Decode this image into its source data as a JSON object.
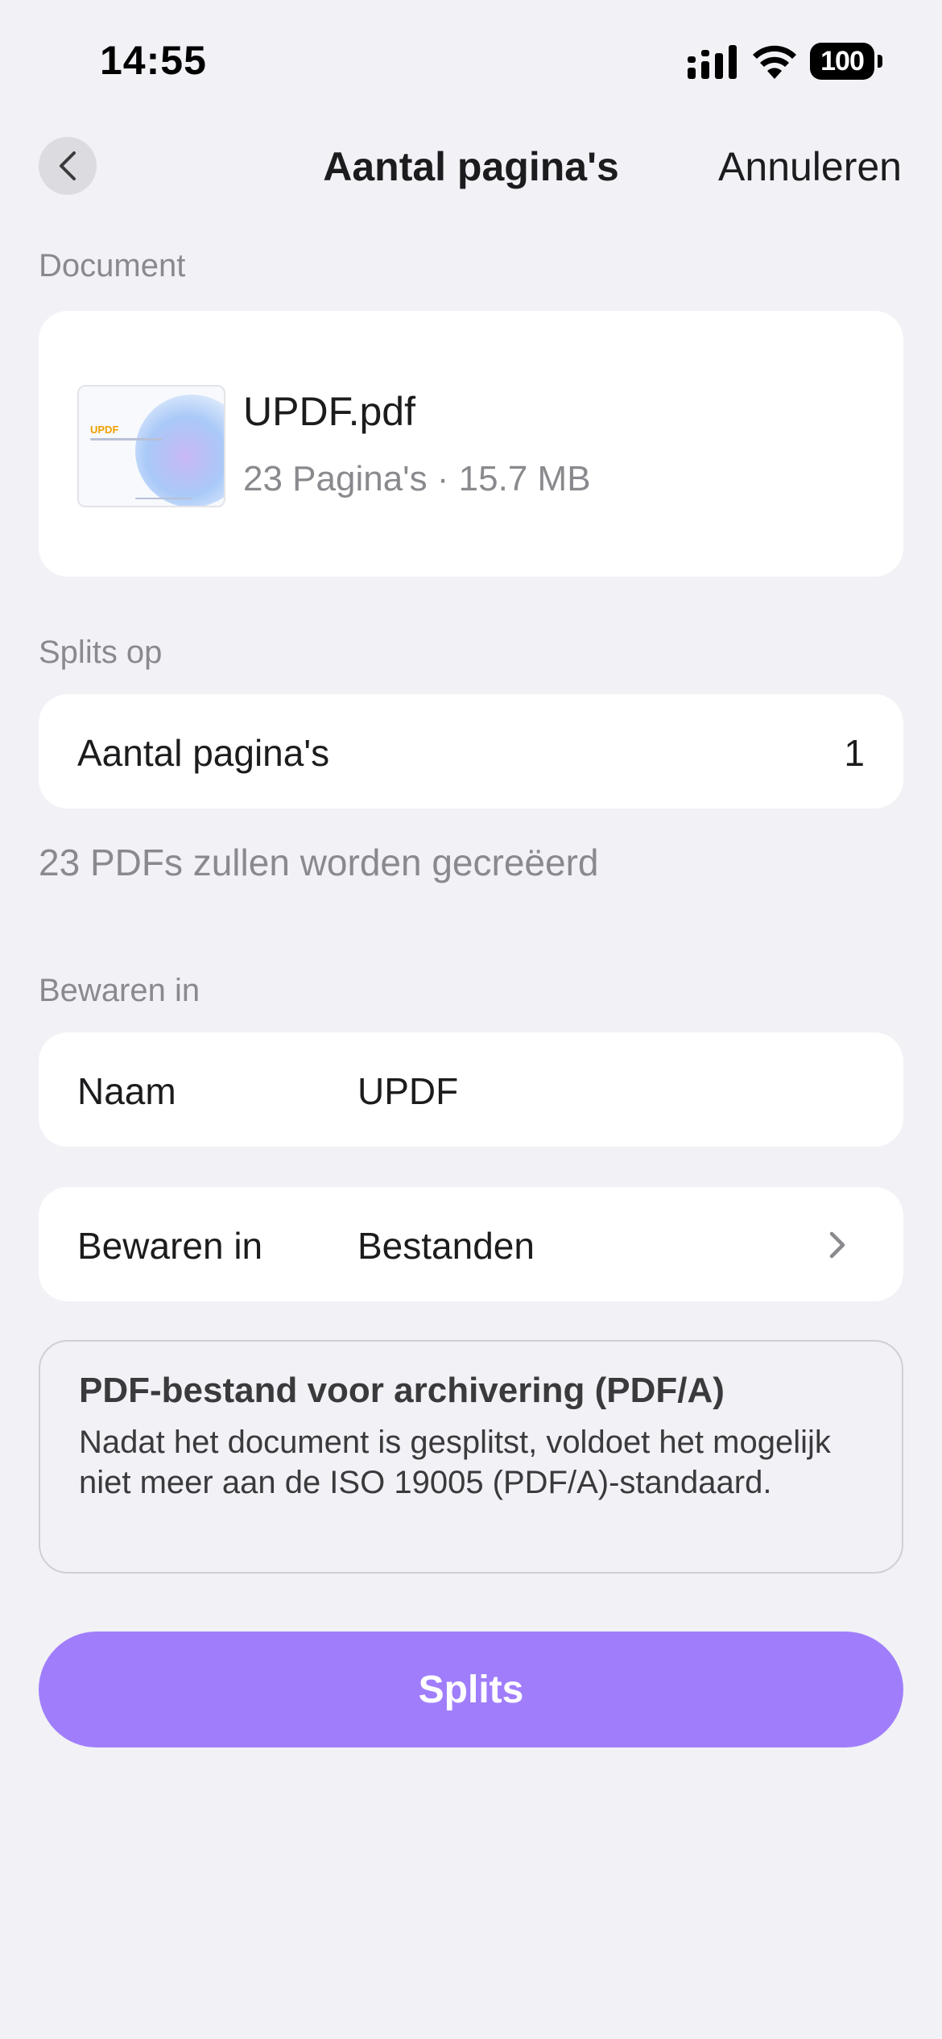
{
  "status_bar": {
    "time": "14:55",
    "battery": "100"
  },
  "nav": {
    "title": "Aantal pagina's",
    "cancel_label": "Annuleren",
    "back_icon": "chevron-left-icon"
  },
  "document_section": {
    "label": "Document",
    "file_name": "UPDF.pdf",
    "file_meta": "23 Pagina's · 15.7 MB",
    "thumbnail_logo": "UPDF"
  },
  "split_section": {
    "label": "Splits op",
    "row_label": "Aantal pagina's",
    "row_value": "1",
    "helper": "23 PDFs zullen worden gecreëerd"
  },
  "save_section": {
    "label": "Bewaren in",
    "name_label": "Naam",
    "name_value": "UPDF",
    "location_label": "Bewaren in",
    "location_value": "Bestanden",
    "chevron_icon": "chevron-right-icon"
  },
  "notice": {
    "title": "PDF-bestand voor archivering (PDF/A)",
    "body": "Nadat het document is gesplitst, voldoet het mogelijk niet meer aan de ISO 19005 (PDF/A)-standaard."
  },
  "actions": {
    "split_label": "Splits"
  },
  "colors": {
    "background": "#F2F1F6",
    "card": "#FFFFFF",
    "accent": "#A07EFB",
    "secondary_text": "#8A8A8E"
  }
}
